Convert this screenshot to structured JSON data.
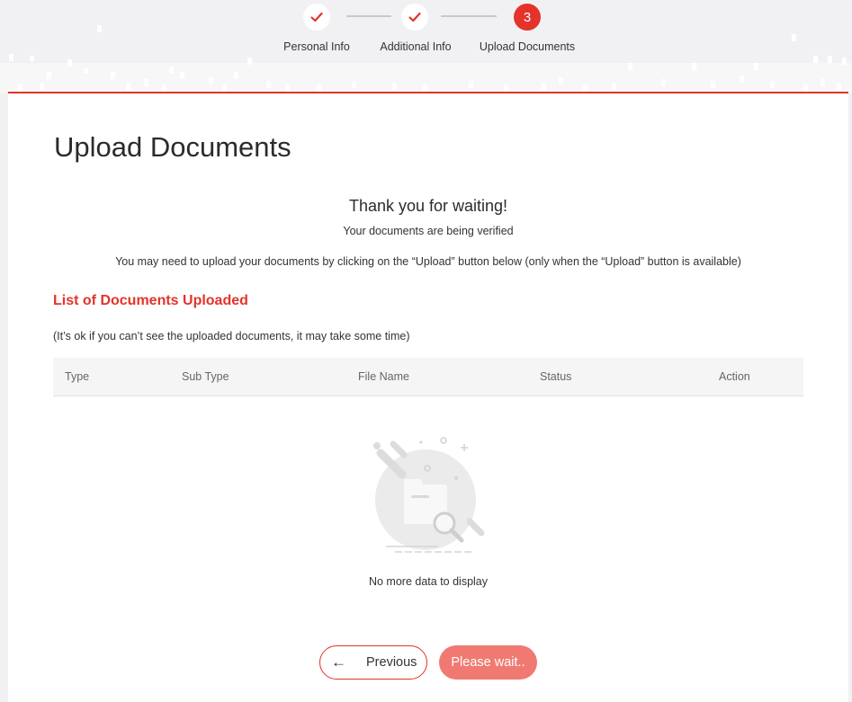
{
  "stepper": {
    "steps": [
      {
        "label": "Personal Info",
        "state": "done",
        "icon": "check-icon"
      },
      {
        "label": "Additional Info",
        "state": "done",
        "icon": "check-icon"
      },
      {
        "label": "Upload Documents",
        "state": "active",
        "number": "3"
      }
    ]
  },
  "page": {
    "title": "Upload Documents",
    "thanks": "Thank you for waiting!",
    "verifying": "Your documents are being verified",
    "upload_note": "You may need to upload your documents by clicking on the “Upload” button below (only when the “Upload” button is available)"
  },
  "documents": {
    "section_title": "List of Documents Uploaded",
    "hint": "(It’s ok if you can’t see the uploaded documents, it may take some time)",
    "columns": [
      "Type",
      "Sub Type",
      "File Name",
      "Status",
      "Action"
    ],
    "rows": [],
    "empty_text": "No more data to display",
    "empty_icon": "folder-search-icon"
  },
  "actions": {
    "previous_label": "Previous",
    "previous_icon": "arrow-left-icon",
    "wait_label": "Please wait.."
  },
  "colors": {
    "accent": "#e4332a",
    "accent_disabled": "#f07a72",
    "background": "#f1f1f3"
  }
}
